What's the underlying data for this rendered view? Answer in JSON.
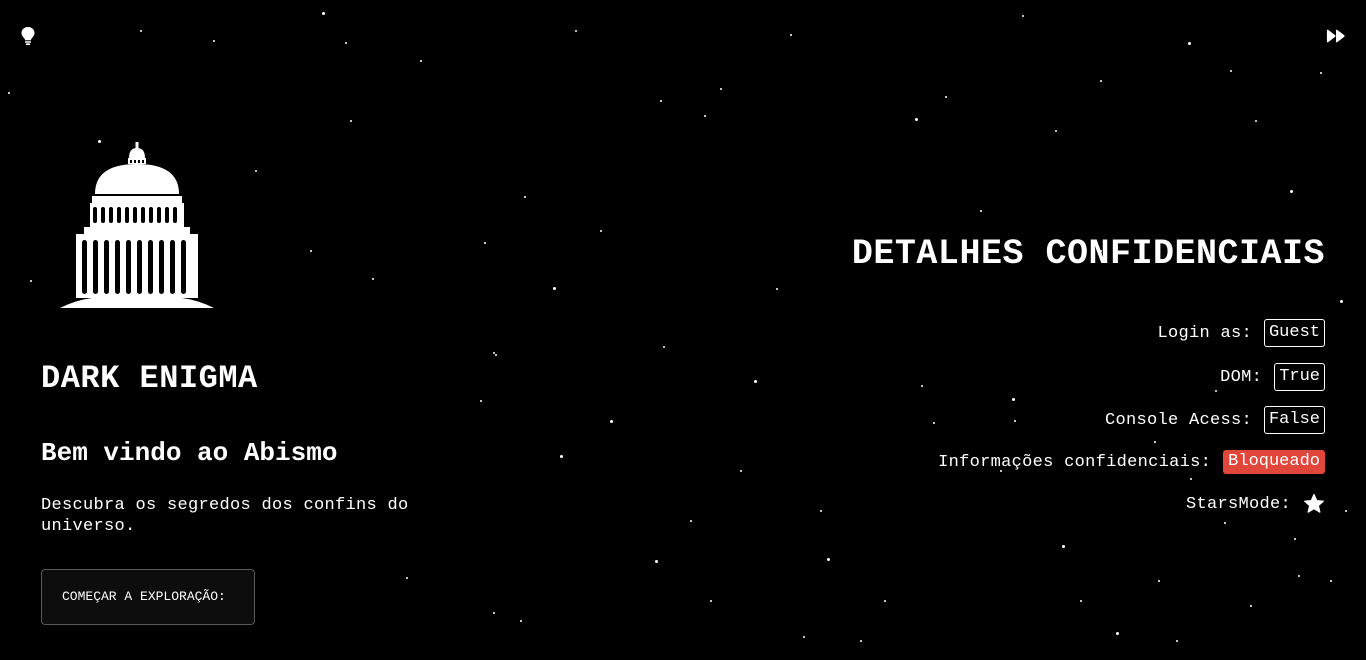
{
  "header": {
    "hint_icon": "lightbulb-icon",
    "skip_icon": "fast-forward-icon"
  },
  "hero": {
    "logo_icon": "capitol-building-icon",
    "title": "DARK ENIGMA",
    "subtitle": "Bem vindo ao Abismo",
    "description": "Descubra os segredos dos confins do universo.",
    "start_button_label": "COMEÇAR A EXPLORAÇÃO:"
  },
  "details": {
    "title": "DETALHES CONFIDENCIAIS",
    "rows": [
      {
        "label": "Login as:",
        "value": "Guest"
      },
      {
        "label": "DOM:",
        "value": "True"
      },
      {
        "label": "Console Acess:",
        "value": "False"
      },
      {
        "label": "Informações confidenciais:",
        "value": "Bloqueado"
      },
      {
        "label": "StarsMode:",
        "icon": "star-icon"
      }
    ]
  },
  "colors": {
    "background": "#000000",
    "text": "#ffffff",
    "blocked_badge": "#e0463a"
  }
}
